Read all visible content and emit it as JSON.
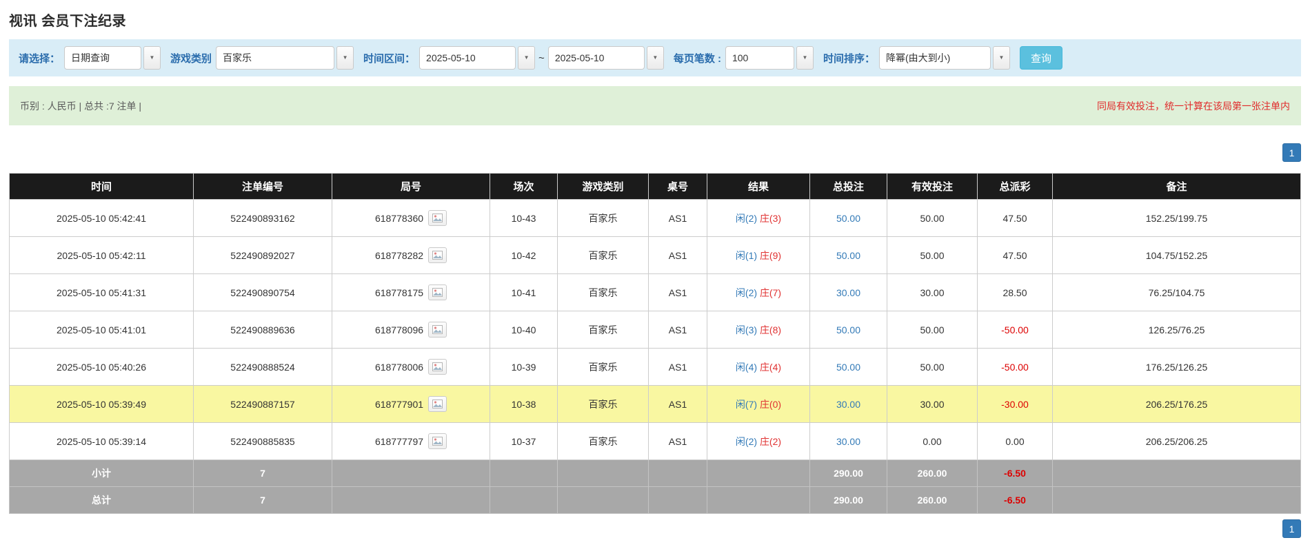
{
  "page": {
    "title": "视讯 会员下注纪录"
  },
  "filters": {
    "select_label": "请选择：",
    "select_value": "日期查询",
    "game_type_label": "游戏类别",
    "game_type_value": "百家乐",
    "time_range_label": "时间区间：",
    "date_from": "2025-05-10",
    "tilde": "~",
    "date_to": "2025-05-10",
    "page_size_label": "每页笔数 :",
    "page_size_value": "100",
    "sort_label": "时间排序：",
    "sort_value": "降幂(由大到小)",
    "search_button": "查询"
  },
  "summary_bar": {
    "left": "币别 : 人民币 | 总共 :7 注单 |",
    "right": "同局有效投注，统一计算在该局第一张注单内"
  },
  "pagination": {
    "page": "1"
  },
  "icons": {
    "dropdown_arrow": "▼",
    "round_picture_icon": "picture-icon"
  },
  "colors": {
    "header_bg": "#1b1b1b",
    "highlight_row": "#f9f7a1",
    "link_blue": "#337ab7",
    "banker_red": "#e03131",
    "negative_red": "#dd0000",
    "pager_blue": "#337ab7",
    "search_button_bg": "#5bc0de",
    "filter_bar_bg": "#d9edf7",
    "summary_bar_bg": "#dff0d8"
  },
  "table": {
    "headers": [
      "时间",
      "注单编号",
      "局号",
      "场次",
      "游戏类别",
      "桌号",
      "结果",
      "总投注",
      "有效投注",
      "总派彩",
      "备注"
    ],
    "rows": [
      {
        "time": "2025-05-10 05:42:41",
        "bet_id": "522490893162",
        "round_id": "618778360",
        "session": "10-43",
        "game": "百家乐",
        "table_no": "AS1",
        "result_player": "闲(2)",
        "result_banker": "庄(3)",
        "total_bet": "50.00",
        "valid_bet": "50.00",
        "payout": "47.50",
        "note": "152.25/199.75",
        "highlight": false
      },
      {
        "time": "2025-05-10 05:42:11",
        "bet_id": "522490892027",
        "round_id": "618778282",
        "session": "10-42",
        "game": "百家乐",
        "table_no": "AS1",
        "result_player": "闲(1)",
        "result_banker": "庄(9)",
        "total_bet": "50.00",
        "valid_bet": "50.00",
        "payout": "47.50",
        "note": "104.75/152.25",
        "highlight": false
      },
      {
        "time": "2025-05-10 05:41:31",
        "bet_id": "522490890754",
        "round_id": "618778175",
        "session": "10-41",
        "game": "百家乐",
        "table_no": "AS1",
        "result_player": "闲(2)",
        "result_banker": "庄(7)",
        "total_bet": "30.00",
        "valid_bet": "30.00",
        "payout": "28.50",
        "note": "76.25/104.75",
        "highlight": false
      },
      {
        "time": "2025-05-10 05:41:01",
        "bet_id": "522490889636",
        "round_id": "618778096",
        "session": "10-40",
        "game": "百家乐",
        "table_no": "AS1",
        "result_player": "闲(3)",
        "result_banker": "庄(8)",
        "total_bet": "50.00",
        "valid_bet": "50.00",
        "payout": "-50.00",
        "note": "126.25/76.25",
        "highlight": false
      },
      {
        "time": "2025-05-10 05:40:26",
        "bet_id": "522490888524",
        "round_id": "618778006",
        "session": "10-39",
        "game": "百家乐",
        "table_no": "AS1",
        "result_player": "闲(4)",
        "result_banker": "庄(4)",
        "total_bet": "50.00",
        "valid_bet": "50.00",
        "payout": "-50.00",
        "note": "176.25/126.25",
        "highlight": false
      },
      {
        "time": "2025-05-10 05:39:49",
        "bet_id": "522490887157",
        "round_id": "618777901",
        "session": "10-38",
        "game": "百家乐",
        "table_no": "AS1",
        "result_player": "闲(7)",
        "result_banker": "庄(0)",
        "total_bet": "30.00",
        "valid_bet": "30.00",
        "payout": "-30.00",
        "note": "206.25/176.25",
        "highlight": true
      },
      {
        "time": "2025-05-10 05:39:14",
        "bet_id": "522490885835",
        "round_id": "618777797",
        "session": "10-37",
        "game": "百家乐",
        "table_no": "AS1",
        "result_player": "闲(2)",
        "result_banker": "庄(2)",
        "total_bet": "30.00",
        "valid_bet": "0.00",
        "payout": "0.00",
        "note": "206.25/206.25",
        "highlight": false
      }
    ],
    "footer_rows": [
      {
        "label": "小计",
        "count": "7",
        "total_bet": "290.00",
        "valid_bet": "260.00",
        "payout": "-6.50"
      },
      {
        "label": "总计",
        "count": "7",
        "total_bet": "290.00",
        "valid_bet": "260.00",
        "payout": "-6.50"
      }
    ]
  }
}
